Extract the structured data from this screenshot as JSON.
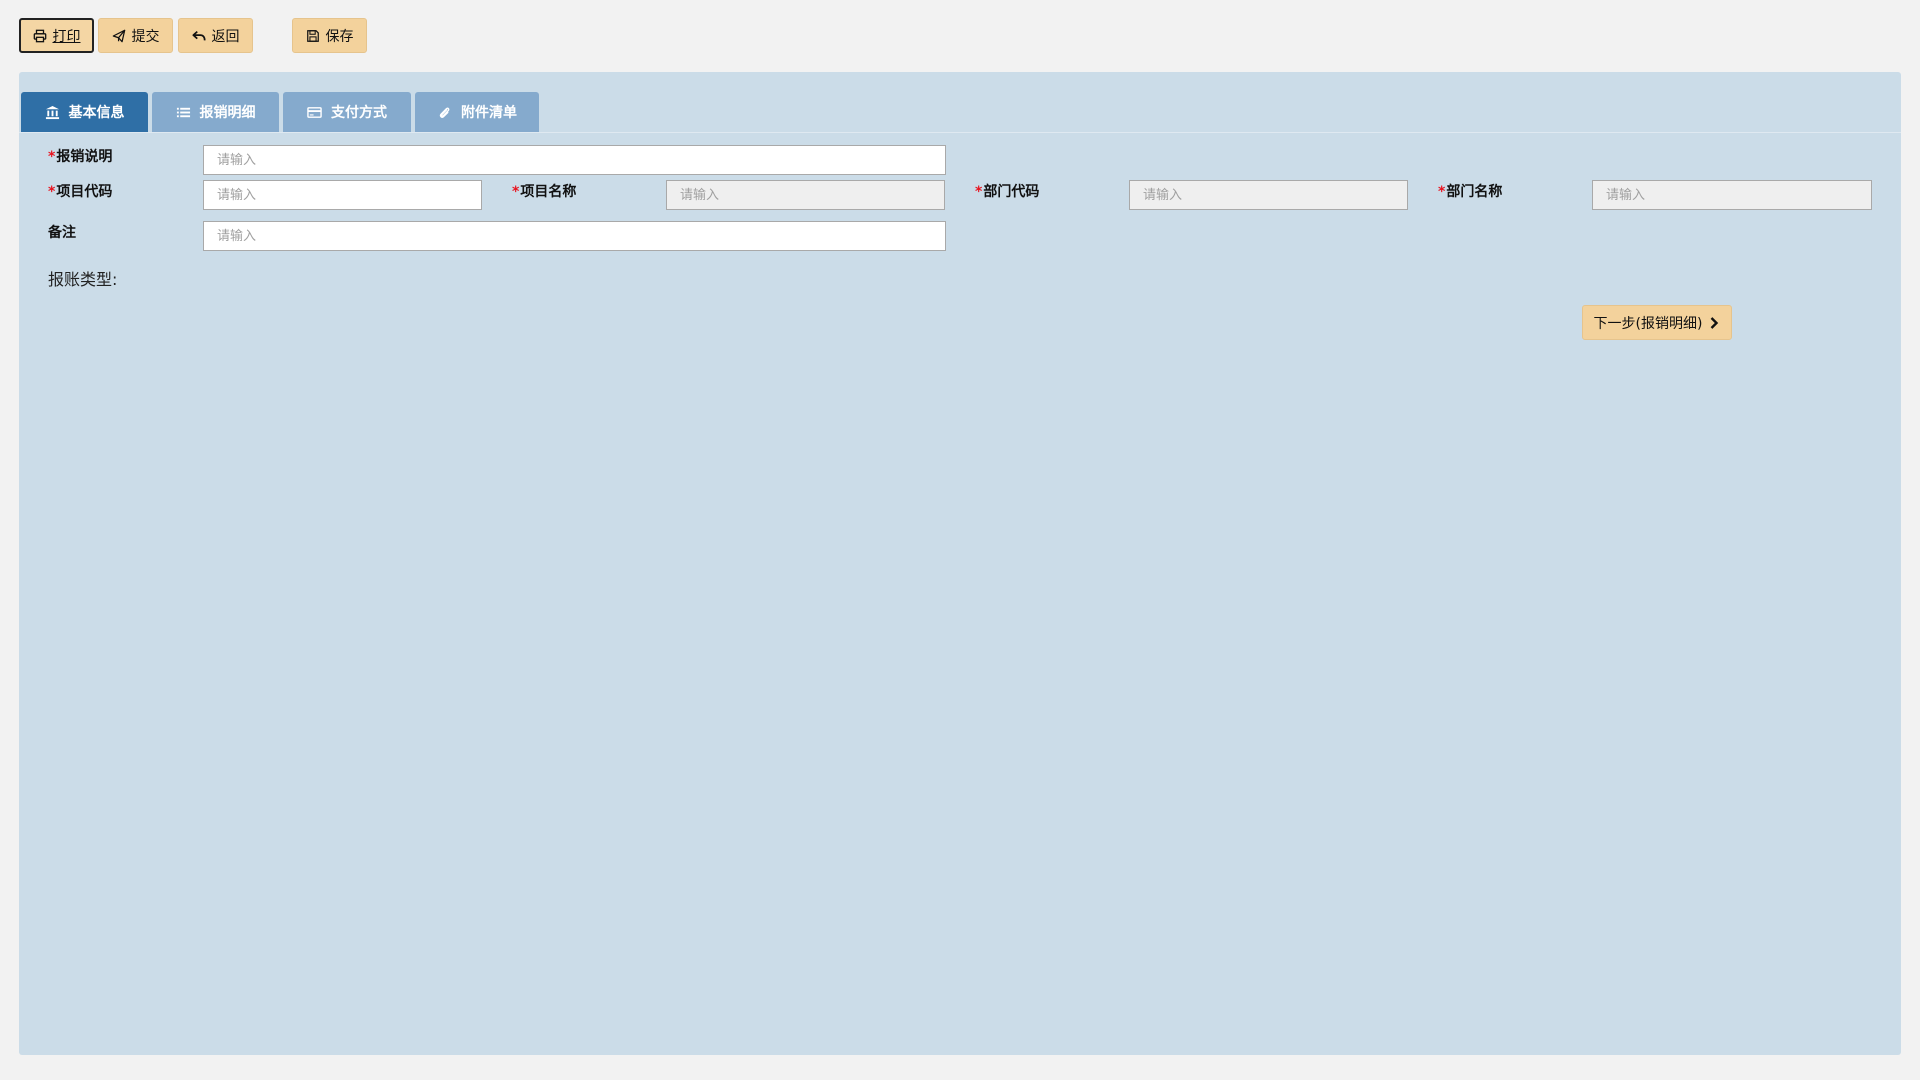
{
  "toolbar": {
    "print": {
      "label": "打印",
      "icon": "print-icon"
    },
    "submit": {
      "label": "提交",
      "icon": "send-icon"
    },
    "back": {
      "label": "返回",
      "icon": "undo-icon"
    },
    "save": {
      "label": "保存",
      "icon": "save-icon"
    }
  },
  "tabs": [
    {
      "label": "基本信息",
      "icon": "bank-icon",
      "active": true
    },
    {
      "label": "报销明细",
      "icon": "list-icon",
      "active": false
    },
    {
      "label": "支付方式",
      "icon": "credit-card-icon",
      "active": false
    },
    {
      "label": "附件清单",
      "icon": "paperclip-icon",
      "active": false
    }
  ],
  "form": {
    "required_mark": "*",
    "description": {
      "label": "报销说明",
      "required": true,
      "value": "",
      "placeholder": "请输入"
    },
    "project_code": {
      "label": "项目代码",
      "required": true,
      "value": "",
      "placeholder": "请输入"
    },
    "project_name": {
      "label": "项目名称",
      "required": true,
      "value": "",
      "placeholder": "请输入",
      "readonly": true
    },
    "dept_code": {
      "label": "部门代码",
      "required": true,
      "value": "",
      "placeholder": "请输入",
      "readonly": true
    },
    "dept_name": {
      "label": "部门名称",
      "required": true,
      "value": "",
      "placeholder": "请输入",
      "readonly": true
    },
    "remark": {
      "label": "备注",
      "required": false,
      "value": "",
      "placeholder": "请输入"
    }
  },
  "reimbursement_type_label": "报账类型:",
  "next_button": {
    "label": "下一步(报销明细)",
    "icon": "chevron-right-icon"
  },
  "colors": {
    "page_bg": "#f2f2f2",
    "panel_bg": "#cbdce8",
    "tab_active": "#2f6fa6",
    "tab_inactive": "#85aacd",
    "button_bg": "#f3d29c",
    "required": "#e8141f"
  }
}
